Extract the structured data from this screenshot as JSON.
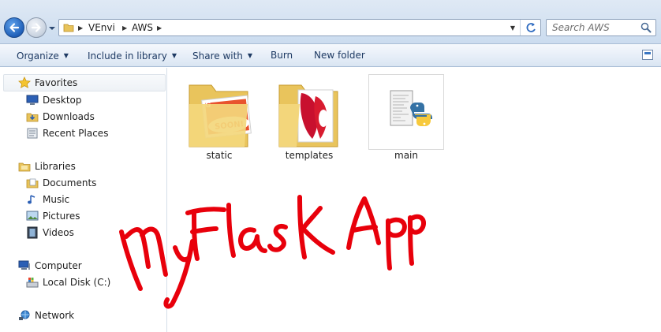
{
  "address_bar": {
    "breadcrumbs": [
      {
        "label": "VEnvi"
      },
      {
        "label": "AWS"
      }
    ],
    "search_placeholder": "Search AWS"
  },
  "command_bar": {
    "organize": "Organize",
    "include_in_library": "Include in library",
    "share_with": "Share with",
    "burn": "Burn",
    "new_folder": "New folder"
  },
  "nav_pane": {
    "favorites": {
      "label": "Favorites",
      "icon": "star-icon",
      "items": [
        {
          "label": "Desktop",
          "icon": "desktop-icon"
        },
        {
          "label": "Downloads",
          "icon": "downloads-icon"
        },
        {
          "label": "Recent Places",
          "icon": "recent-places-icon"
        }
      ]
    },
    "libraries": {
      "label": "Libraries",
      "icon": "libraries-icon",
      "items": [
        {
          "label": "Documents",
          "icon": "documents-icon"
        },
        {
          "label": "Music",
          "icon": "music-icon"
        },
        {
          "label": "Pictures",
          "icon": "pictures-icon"
        },
        {
          "label": "Videos",
          "icon": "videos-icon"
        }
      ]
    },
    "computer": {
      "label": "Computer",
      "icon": "computer-icon",
      "items": [
        {
          "label": "Local Disk (C:)",
          "icon": "local-disk-icon"
        }
      ]
    },
    "network": {
      "label": "Network",
      "icon": "network-icon"
    }
  },
  "content": {
    "items": [
      {
        "label": "static",
        "type": "folder"
      },
      {
        "label": "templates",
        "type": "folder"
      },
      {
        "label": "main",
        "type": "python-file"
      }
    ],
    "annotation": "My FlasK App"
  },
  "colors": {
    "annotation_red": "#e8000b",
    "folder_yellow": "#f3d77c",
    "command_text": "#1e3a63"
  }
}
